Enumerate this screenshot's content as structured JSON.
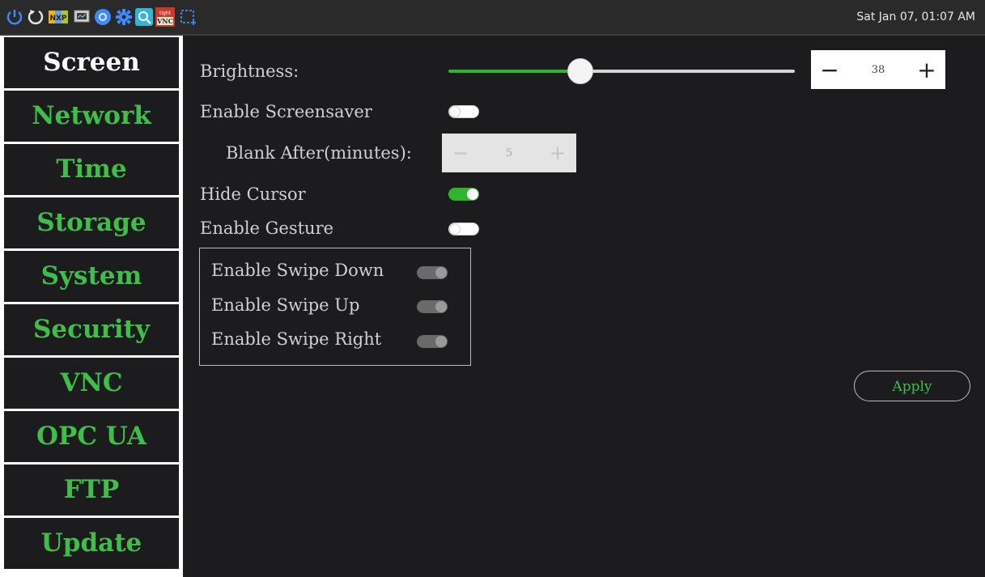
{
  "taskbar": {
    "clock": "Sat Jan 07, 01:07 AM",
    "icons": [
      "power-icon",
      "restart-icon",
      "nxp-icon",
      "monitor-icon",
      "browser-icon",
      "gear-icon",
      "search-app-icon",
      "vnc-icon",
      "screenshot-icon"
    ]
  },
  "sidebar": {
    "items": [
      {
        "label": "Screen",
        "active": true
      },
      {
        "label": "Network"
      },
      {
        "label": "Time"
      },
      {
        "label": "Storage"
      },
      {
        "label": "System"
      },
      {
        "label": "Security"
      },
      {
        "label": "VNC"
      },
      {
        "label": "OPC UA"
      },
      {
        "label": "FTP"
      },
      {
        "label": "Update"
      }
    ]
  },
  "screen": {
    "brightness": {
      "label": "Brightness:",
      "value": "38",
      "fraction": 0.38,
      "minus": "−",
      "plus": "+"
    },
    "screensaver": {
      "label": "Enable Screensaver",
      "enabled": false
    },
    "blank_after": {
      "label": "Blank After(minutes):",
      "value": "5",
      "minus": "−",
      "plus": "+",
      "disabled": true
    },
    "hide_cursor": {
      "label": "Hide Cursor",
      "enabled": true
    },
    "gesture": {
      "label": "Enable Gesture",
      "enabled": false
    },
    "swipe_down": {
      "label": "Enable Swipe Down",
      "enabled": true,
      "disabled": true
    },
    "swipe_up": {
      "label": "Enable Swipe Up",
      "enabled": true,
      "disabled": true
    },
    "swipe_right": {
      "label": "Enable Swipe Right",
      "enabled": true,
      "disabled": true
    },
    "apply_label": "Apply"
  },
  "colors": {
    "accent": "#2fb52f",
    "label_green": "#3fbf4a",
    "background": "#1c1c1e"
  }
}
